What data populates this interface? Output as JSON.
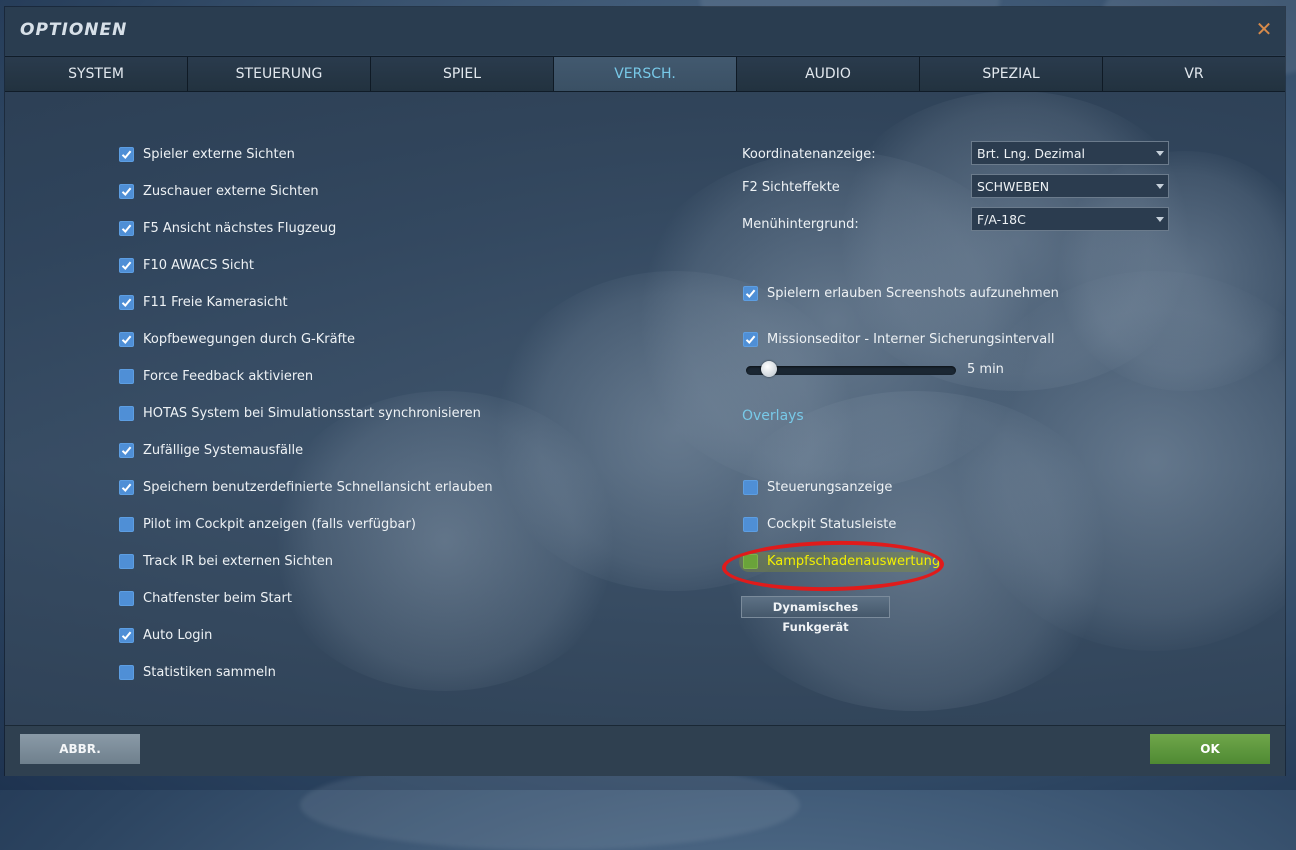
{
  "window": {
    "title": "OPTIONEN",
    "close_glyph": "✕"
  },
  "tabs": [
    {
      "label": "SYSTEM",
      "active": false
    },
    {
      "label": "STEUERUNG",
      "active": false
    },
    {
      "label": "SPIEL",
      "active": false
    },
    {
      "label": "VERSCH.",
      "active": true
    },
    {
      "label": "AUDIO",
      "active": false
    },
    {
      "label": "SPEZIAL",
      "active": false
    },
    {
      "label": "VR",
      "active": false
    }
  ],
  "left_options": [
    {
      "label": "Spieler externe Sichten",
      "checked": true
    },
    {
      "label": "Zuschauer externe Sichten",
      "checked": true
    },
    {
      "label": "F5 Ansicht nächstes Flugzeug",
      "checked": true
    },
    {
      "label": "F10 AWACS Sicht",
      "checked": true
    },
    {
      "label": "F11 Freie Kamerasicht",
      "checked": true
    },
    {
      "label": "Kopfbewegungen durch G-Kräfte",
      "checked": true
    },
    {
      "label": "Force Feedback aktivieren",
      "checked": false
    },
    {
      "label": "HOTAS System bei Simulationsstart synchronisieren",
      "checked": false
    },
    {
      "label": "Zufällige Systemausfälle",
      "checked": true
    },
    {
      "label": "Speichern benutzerdefinierte Schnellansicht erlauben",
      "checked": true
    },
    {
      "label": "Pilot im Cockpit anzeigen (falls verfügbar)",
      "checked": false
    },
    {
      "label": "Track IR bei externen Sichten",
      "checked": false
    },
    {
      "label": "Chatfenster beim Start",
      "checked": false
    },
    {
      "label": "Auto Login",
      "checked": true
    },
    {
      "label": "Statistiken sammeln",
      "checked": false
    }
  ],
  "right": {
    "selects": [
      {
        "label": "Koordinatenanzeige:",
        "value": "Brt. Lng. Dezimal"
      },
      {
        "label": "F2 Sichteffekte",
        "value": "SCHWEBEN"
      },
      {
        "label": "Menühintergrund:",
        "value": "F/A-18C"
      }
    ],
    "screenshots": {
      "label": "Spielern erlauben Screenshots aufzunehmen",
      "checked": true
    },
    "autosave": {
      "label": "Missionseditor - Interner Sicherungsintervall",
      "checked": true
    },
    "slider": {
      "value_text": "5 min",
      "level": 0.05
    },
    "overlays_title": "Overlays",
    "overlays": [
      {
        "label": "Steuerungsanzeige",
        "checked": false
      },
      {
        "label": "Cockpit Statusleiste",
        "checked": false
      },
      {
        "label": "Kampfschadenauswertung",
        "checked": false
      }
    ],
    "radio_button": "Dynamisches Funkgerät"
  },
  "footer": {
    "cancel": "ABBR.",
    "ok": "OK"
  },
  "colors": {
    "accent": "#78c9e8",
    "checkbox": "#4f8fd6",
    "ok": "#5a9a3c",
    "highlight_ring": "#e01b1b",
    "highlight_text": "#f3f000"
  }
}
